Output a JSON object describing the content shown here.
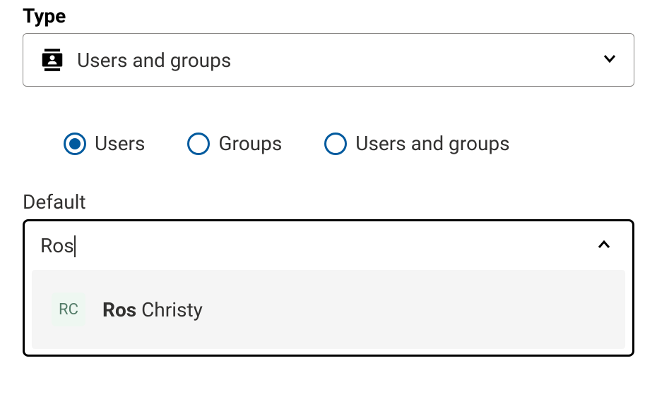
{
  "type_section": {
    "label": "Type",
    "selected_value": "Users and groups"
  },
  "radios": {
    "items": [
      {
        "label": "Users",
        "selected": true
      },
      {
        "label": "Groups",
        "selected": false
      },
      {
        "label": "Users and groups",
        "selected": false
      }
    ]
  },
  "default_section": {
    "label": "Default",
    "input_value": "Ros",
    "suggestion": {
      "initials": "RC",
      "name_bold": "Ros",
      "name_rest": " Christy"
    }
  },
  "colors": {
    "accent": "#005a9e"
  }
}
